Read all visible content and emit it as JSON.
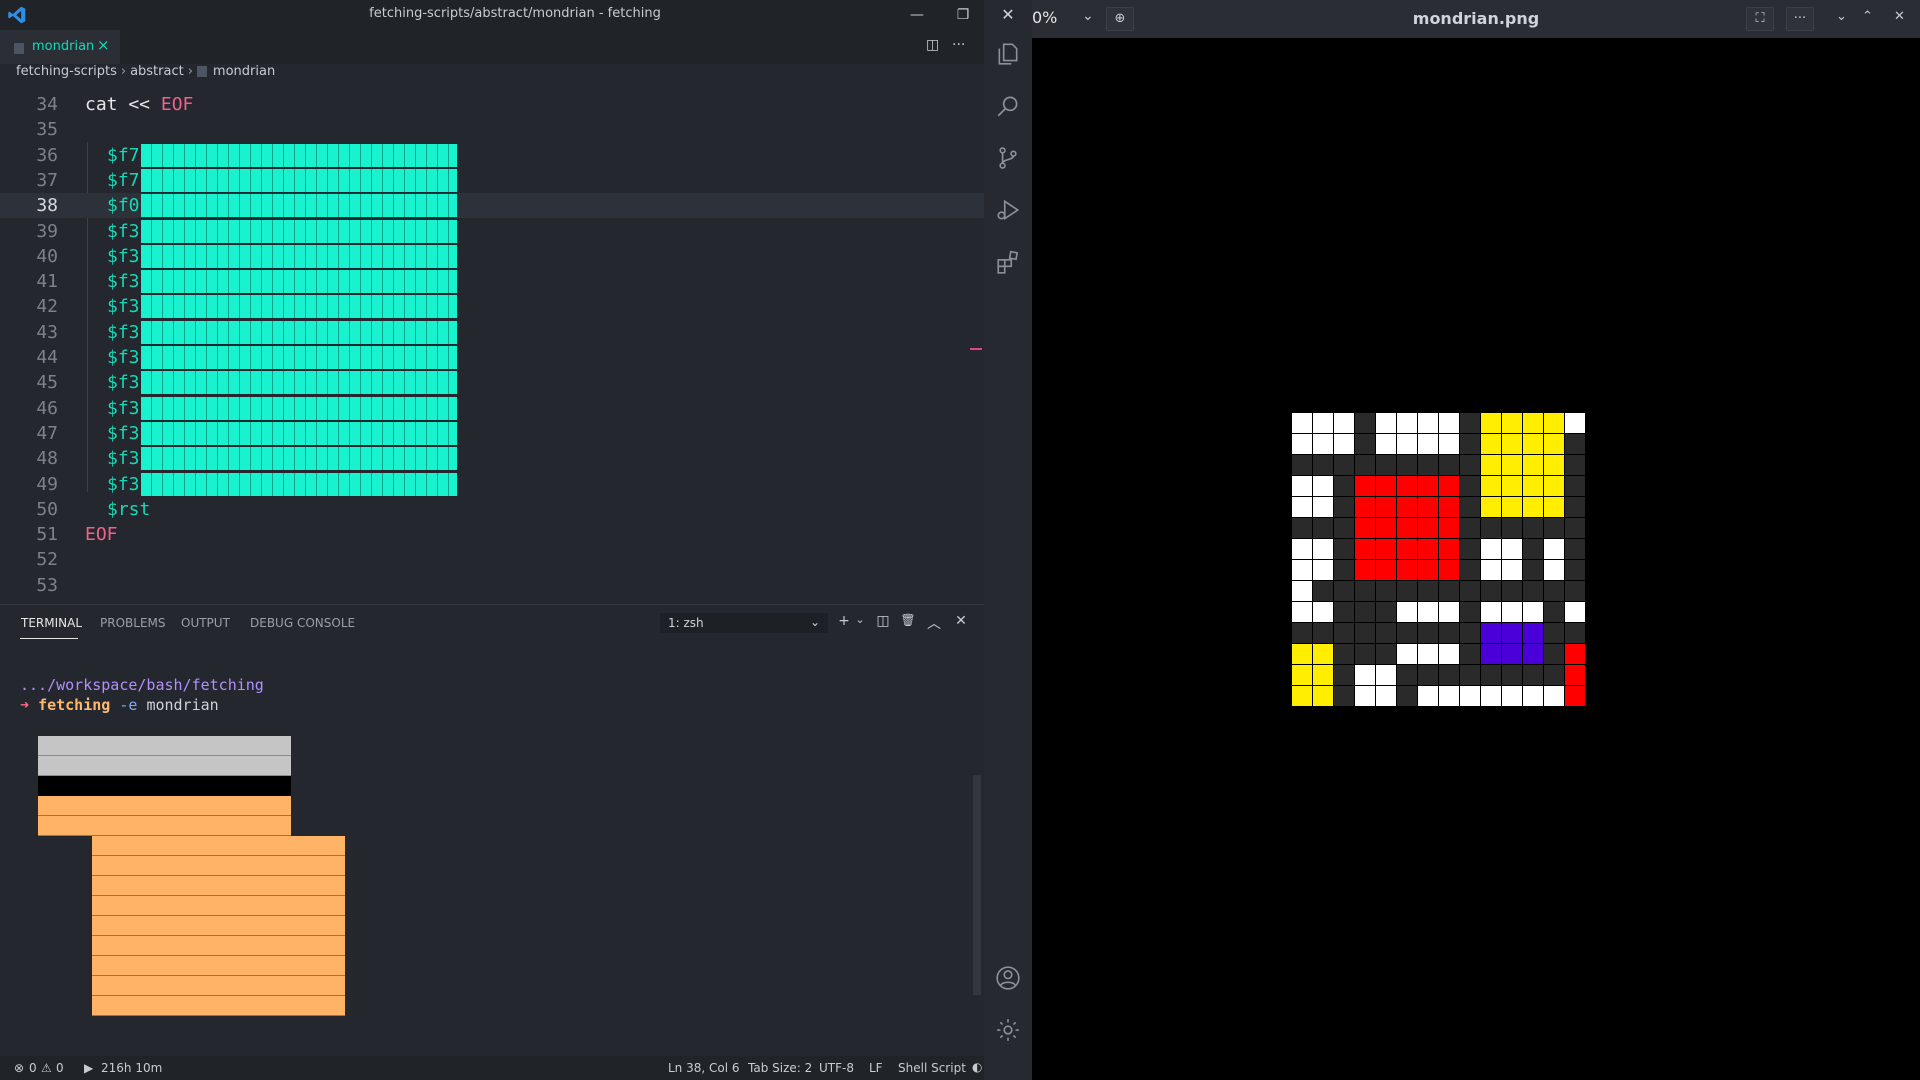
{
  "window": {
    "title": "fetching-scripts/abstract/mondrian - fetching",
    "minimize": "—",
    "restore": "❐",
    "close": "✕"
  },
  "tab": {
    "label": "mondrian",
    "close": "×",
    "split": "◫",
    "more": "···"
  },
  "breadcrumb": [
    "fetching-scripts",
    "abstract",
    "mondrian"
  ],
  "editor": {
    "lines": [
      {
        "n": "34",
        "text": "cat << ",
        "tail": "EOF",
        "kind": "cat"
      },
      {
        "n": "35",
        "text": "",
        "kind": "blank"
      },
      {
        "n": "36",
        "text": "$f7",
        "kind": "block"
      },
      {
        "n": "37",
        "text": "$f7",
        "kind": "block"
      },
      {
        "n": "38",
        "text": "$f0",
        "kind": "block",
        "current": true
      },
      {
        "n": "39",
        "text": "$f3",
        "kind": "block"
      },
      {
        "n": "40",
        "text": "$f3",
        "kind": "block"
      },
      {
        "n": "41",
        "text": "$f3",
        "kind": "block"
      },
      {
        "n": "42",
        "text": "$f3",
        "kind": "block"
      },
      {
        "n": "43",
        "text": "$f3",
        "kind": "block"
      },
      {
        "n": "44",
        "text": "$f3",
        "kind": "block"
      },
      {
        "n": "45",
        "text": "$f3",
        "kind": "block"
      },
      {
        "n": "46",
        "text": "$f3",
        "kind": "block"
      },
      {
        "n": "47",
        "text": "$f3",
        "kind": "block"
      },
      {
        "n": "48",
        "text": "$f3",
        "kind": "block"
      },
      {
        "n": "49",
        "text": "$f3",
        "kind": "block"
      },
      {
        "n": "50",
        "text": "$rst",
        "kind": "var"
      },
      {
        "n": "51",
        "text": "EOF",
        "kind": "eof"
      },
      {
        "n": "52",
        "text": "",
        "kind": "blank"
      },
      {
        "n": "53",
        "text": "",
        "kind": "blank"
      }
    ]
  },
  "panel": {
    "tabs": [
      "TERMINAL",
      "PROBLEMS",
      "OUTPUT",
      "DEBUG CONSOLE"
    ],
    "active_tab": "TERMINAL",
    "terminal_select": "1: zsh",
    "actions": {
      "add": "+",
      "add_menu": "⌄",
      "split": "◫",
      "kill": "🗑",
      "maximize": "︿",
      "close": "✕"
    }
  },
  "terminal": {
    "path": ".../workspace/bash/fetching",
    "prompt": "➜",
    "command": "fetching",
    "flag": "-e",
    "arg": "mondrian"
  },
  "status": {
    "errors": "0",
    "warnings": "0",
    "uptime": "216h 10m",
    "cursor": "Ln 38, Col 6",
    "tab_size": "Tab Size: 2",
    "encoding": "UTF-8",
    "eol": "LF",
    "language": "Shell Script"
  },
  "activity_icons": [
    "explorer-icon",
    "search-icon",
    "source-control-icon",
    "run-debug-icon",
    "extensions-icon",
    "account-icon",
    "settings-icon"
  ],
  "viewer": {
    "zoom": "0%",
    "title": "mondrian.png",
    "colors": {
      "white": "#ffffff",
      "yellow": "#ffee00",
      "red": "#ff0000",
      "blue": "#4b00d9",
      "dark": "#2a2a2a"
    },
    "grid": [
      "WWWKWWWWKYYYYW",
      "WWWKWWWWKYYYYK",
      "KKKKKKKKKYYYYK",
      "WWKRRRRRKYYYYK",
      "WWKRRRRRKYYYYK",
      "KKKRRRRRKKKKKK",
      "WWKRRRRRKWWKWK",
      "WWKRRRRRKWWKWK",
      "WKKKKKKKKKKKKK",
      "WWKKKWWWKWWWKW",
      "KKKKKKKKKBBBKK",
      "YYKKKWWWKBBBKR",
      "YYKWWKKKKKKKKR",
      "YYKWWKWWWWWWWR"
    ]
  }
}
